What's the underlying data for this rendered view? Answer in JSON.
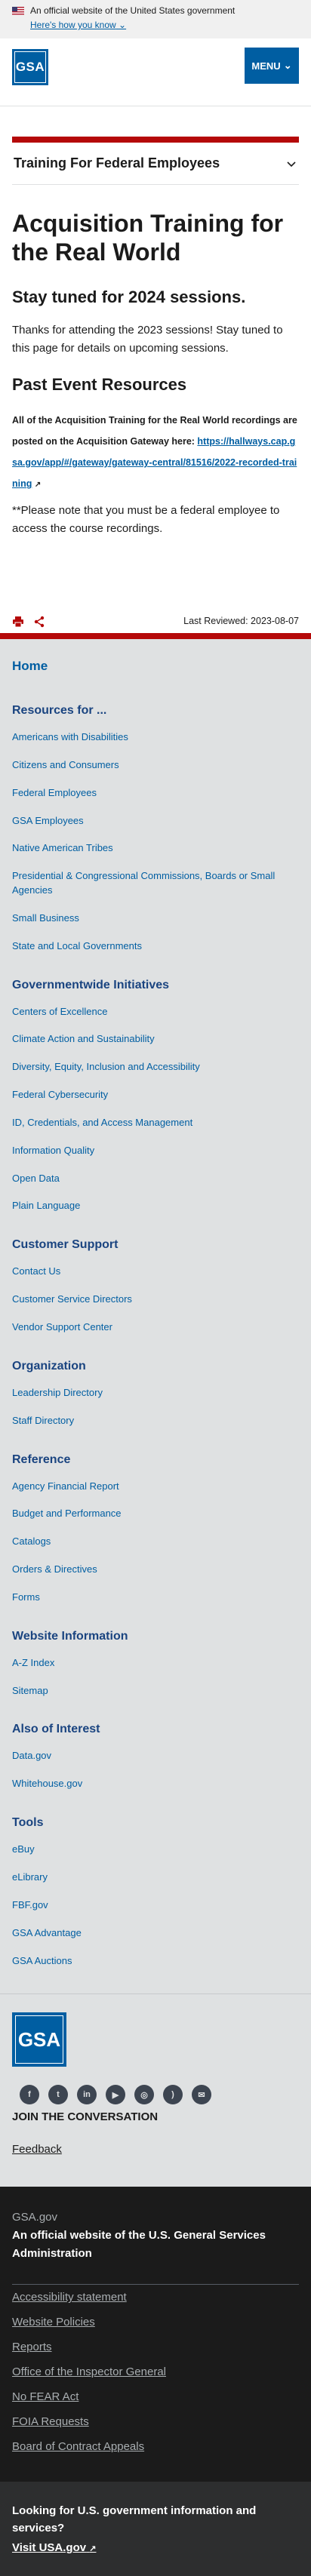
{
  "banner": {
    "official_text": "An official website of the United States government",
    "how_you_know": "Here's how you know"
  },
  "header": {
    "logo_text": "GSA",
    "menu_label": "MENU"
  },
  "section_nav": {
    "title": "Training For Federal Employees"
  },
  "main": {
    "title": "Acquisition Training for the Real World",
    "subtitle": "Stay tuned for 2024 sessions.",
    "intro": "Thanks for attending the 2023 sessions! Stay tuned to this page for details on upcoming sessions.",
    "past_heading": "Past Event Resources",
    "resources_text": "All of the Acquisition Training for the Real World recordings are posted on the Acquisition Gateway here:",
    "resources_link": "https://hallways.cap.gsa.gov/app/#/gateway/gateway-central/81516/2022-recorded-training",
    "note": "**Please note that you must be a federal employee to access the course recordings."
  },
  "page_meta": {
    "last_reviewed": "Last Reviewed: 2023-08-07"
  },
  "site_nav": {
    "home": "Home",
    "groups": [
      {
        "title": "Resources for ...",
        "links": [
          "Americans with Disabilities",
          "Citizens and Consumers",
          "Federal Employees",
          "GSA Employees",
          "Native American Tribes",
          "Presidential & Congressional Commissions, Boards or Small Agencies",
          "Small Business",
          "State and Local Governments"
        ]
      },
      {
        "title": "Governmentwide Initiatives",
        "links": [
          "Centers of Excellence",
          "Climate Action and Sustainability",
          "Diversity, Equity, Inclusion and Accessibility",
          "Federal Cybersecurity",
          "ID, Credentials, and Access Management",
          "Information Quality",
          "Open Data",
          "Plain Language"
        ]
      },
      {
        "title": "Customer Support",
        "links": [
          "Contact Us",
          "Customer Service Directors",
          "Vendor Support Center"
        ]
      },
      {
        "title": "Organization",
        "links": [
          "Leadership Directory",
          "Staff Directory"
        ]
      },
      {
        "title": "Reference",
        "links": [
          "Agency Financial Report",
          "Budget and Performance",
          "Catalogs",
          "Orders & Directives",
          "Forms"
        ]
      },
      {
        "title": "Website Information",
        "links": [
          "A-Z Index",
          "Sitemap"
        ]
      },
      {
        "title": "Also of Interest",
        "links": [
          "Data.gov",
          "Whitehouse.gov"
        ]
      },
      {
        "title": "Tools",
        "links": [
          "eBuy",
          "eLibrary",
          "FBF.gov",
          "GSA Advantage",
          "GSA Auctions"
        ]
      }
    ]
  },
  "footer": {
    "logo_text": "GSA",
    "social_icons": [
      "facebook-icon",
      "twitter-icon",
      "linkedin-icon",
      "youtube-icon",
      "instagram-icon",
      "rss-icon",
      "email-icon"
    ],
    "join": "JOIN THE CONVERSATION",
    "feedback": "Feedback"
  },
  "identifier": {
    "domain": "GSA.gov",
    "description": "An official website of the U.S. General Services Administration",
    "links": [
      "Accessibility statement",
      "Website Policies",
      "Reports",
      "Office of the Inspector General",
      "No FEAR Act",
      "FOIA Requests",
      "Board of Contract Appeals"
    ]
  },
  "usagov": {
    "question": "Looking for U.S. government information and services?",
    "link": "Visit USA.gov"
  },
  "colors": {
    "primary": "#005ea2",
    "accent_red": "#b50909",
    "nav_bg": "#dfe1e2",
    "identifier_bg": "#1b1b1b"
  }
}
